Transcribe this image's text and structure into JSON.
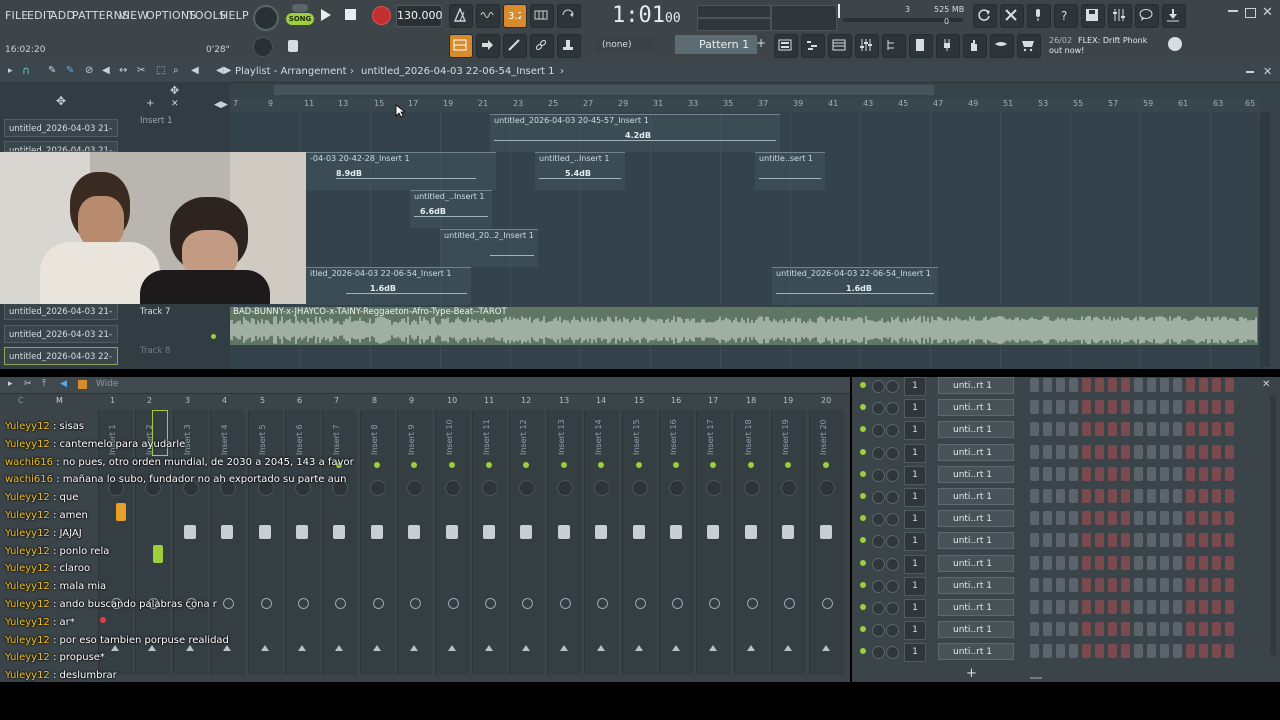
{
  "menu": [
    "FILE",
    "EDIT",
    "ADD",
    "PATTERNS",
    "VIEW",
    "OPTIONS",
    "TOOLS",
    "HELP"
  ],
  "transport": {
    "mode_badge": "SONG",
    "tempo": "130.000",
    "time": "1:01",
    "time_small": "00",
    "cpu_small": "3",
    "memory": "525 MB",
    "memory_zero": "0",
    "hint_time": "16:02:20",
    "hint_length": "0'28\""
  },
  "pattern_selector": {
    "none": "(none)",
    "pattern": "Pattern 1"
  },
  "news": {
    "date": "26/02",
    "text": "FLEX: Drift Phonk",
    "text2": "out now!"
  },
  "playlist": {
    "title": "Playlist - Arrangement",
    "breadcrumb_file": "untitled_2026-04-03 22-06-54_Insert 1",
    "timeline_ticks": [
      "7",
      "9",
      "11",
      "13",
      "15",
      "17",
      "19",
      "21",
      "23",
      "25",
      "27",
      "29",
      "31",
      "33",
      "35",
      "37",
      "39",
      "41",
      "43",
      "45",
      "47",
      "49",
      "51",
      "53",
      "55",
      "57",
      "59",
      "61",
      "63",
      "65"
    ],
    "track_headers": [
      "Insert 1",
      "Track 7",
      "Track 8"
    ],
    "patterns": [
      "untitled_2026-04-03 21-",
      "untitled_2026-04-03 21-",
      "untitled_2026-04-03 21-",
      "untitled_2026-04-03 21-",
      "untitled_2026-04-03 22-"
    ],
    "clips": [
      {
        "label": "untitled_2026-04-03 20-45-57_Insert 1",
        "db": "4.2dB"
      },
      {
        "label": "-04-03 20-42-28_Insert 1",
        "db": "8.9dB"
      },
      {
        "label": "untitled_..Insert 1",
        "db": "5.4dB"
      },
      {
        "label": "untitle..sert 1",
        "db": ""
      },
      {
        "label": "untitled_..Insert 1",
        "db": "6.6dB"
      },
      {
        "label": "untitled_20..2_Insert 1",
        "db": ""
      },
      {
        "label": "itled_2026-04-03 22-06-54_Insert 1",
        "db": "1.6dB"
      },
      {
        "label": "untitled_2026-04-03 22-06-54_Insert 1",
        "db": "1.6dB"
      }
    ],
    "audio_clip": "BAD-BUNNY-x-JHAYCO-x-TAINY-Reggaeton-Afro-Type-Beat--TAROT"
  },
  "mixer": {
    "view_label": "Wide",
    "headers": [
      "C",
      "M"
    ],
    "numbers": [
      "1",
      "2",
      "3",
      "4",
      "5",
      "6",
      "7",
      "8",
      "9",
      "10",
      "11",
      "12",
      "13",
      "14",
      "15",
      "16",
      "17",
      "18",
      "19",
      "20"
    ],
    "inserts": [
      "Insert 1",
      "Insert 2",
      "Insert 3",
      "Insert 4",
      "Insert 5",
      "Insert 6",
      "Insert 7",
      "Insert 8",
      "Insert 9",
      "Insert 10",
      "Insert 11",
      "Insert 12",
      "Insert 13",
      "Insert 14",
      "Insert 15",
      "Insert 16",
      "Insert 17",
      "Insert 18",
      "Insert 19",
      "Insert 20"
    ]
  },
  "chat": [
    {
      "user": "Yuleyy12",
      "msg": "sisas"
    },
    {
      "user": "Yuleyy12",
      "msg": "cantemelo para ayudarle"
    },
    {
      "user": "wachi616",
      "msg": "no pues, otro orden mundial, de 2030 a 2045, 143 a favor"
    },
    {
      "user": "wachi616",
      "msg": "mañana lo subo, fundador no ah exportado su parte aun"
    },
    {
      "user": "Yuleyy12",
      "msg": "que"
    },
    {
      "user": "Yuleyy12",
      "msg": "amen"
    },
    {
      "user": "Yuleyy12",
      "msg": "JAJAJ"
    },
    {
      "user": "Yuleyy12",
      "msg": "ponlo rela"
    },
    {
      "user": "Yuleyy12",
      "msg": "claroo"
    },
    {
      "user": "Yuleyy12",
      "msg": "mala mia"
    },
    {
      "user": "Yuleyy12",
      "msg": "ando buscando palabras cona r"
    },
    {
      "user": "Yuleyy12",
      "msg": "ar*"
    },
    {
      "user": "Yuleyy12",
      "msg": "por eso tambien porpuse realidad"
    },
    {
      "user": "Yuleyy12",
      "msg": "propuse*"
    },
    {
      "user": "Yuleyy12",
      "msg": "deslumbrar"
    }
  ],
  "rack": {
    "rows": [
      {
        "num": "1",
        "name": "unti..rt 1"
      },
      {
        "num": "1",
        "name": "unti..rt 1"
      },
      {
        "num": "1",
        "name": "unti..rt 1"
      },
      {
        "num": "1",
        "name": "unti..rt 1"
      },
      {
        "num": "1",
        "name": "unti..rt 1"
      },
      {
        "num": "1",
        "name": "unti..rt 1"
      },
      {
        "num": "1",
        "name": "unti..rt 1"
      },
      {
        "num": "1",
        "name": "unti..rt 1"
      },
      {
        "num": "1",
        "name": "unti..rt 1"
      },
      {
        "num": "1",
        "name": "unti..rt 1"
      },
      {
        "num": "1",
        "name": "unti..rt 1"
      },
      {
        "num": "1",
        "name": "unti..rt 1"
      },
      {
        "num": "1",
        "name": "unti..rt 1"
      }
    ],
    "add_symbol": "+"
  },
  "colors": {
    "accent_green": "#9ccf3a",
    "record_red": "#e03a3a",
    "chat_user": "#f5c219",
    "audio_clip": "#5f7664"
  }
}
